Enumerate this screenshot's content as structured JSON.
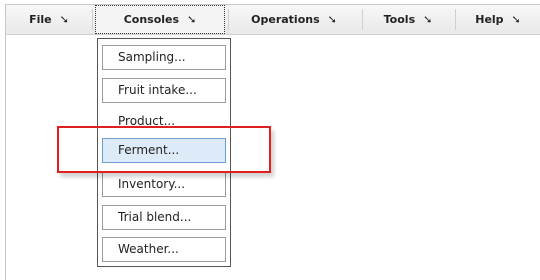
{
  "menubar": {
    "items": [
      {
        "label": "File",
        "arrow": "➘"
      },
      {
        "label": "Consoles",
        "arrow": "➘"
      },
      {
        "label": "Operations",
        "arrow": "➘"
      },
      {
        "label": "Tools",
        "arrow": "➘"
      },
      {
        "label": "Help",
        "arrow": "➘"
      }
    ]
  },
  "consoles_menu": {
    "items": [
      {
        "label": "Sampling..."
      },
      {
        "label": "Fruit intake..."
      },
      {
        "label": "Product..."
      },
      {
        "label": "Ferment..."
      },
      {
        "label": "Inventory..."
      },
      {
        "label": "Trial blend..."
      },
      {
        "label": "Weather..."
      }
    ],
    "highlighted": "Ferment...",
    "highlight_color": "#ddeaf7",
    "callout_color": "#e02020"
  }
}
